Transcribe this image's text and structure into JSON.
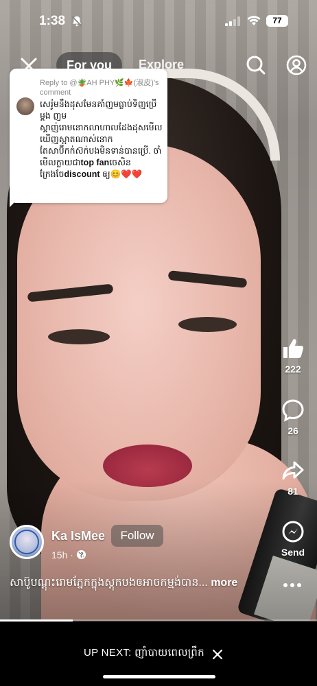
{
  "status_bar": {
    "time": "1:38",
    "battery": "77",
    "icons": [
      "bell-off-icon",
      "cellular-signal-icon",
      "wifi-icon",
      "battery-icon"
    ]
  },
  "top_nav": {
    "tabs": [
      {
        "label": "For you",
        "active": true
      },
      {
        "label": "Explore",
        "active": false
      }
    ],
    "icons": [
      "close-icon",
      "search-icon",
      "profile-icon"
    ]
  },
  "comment_card": {
    "reply_to": "Reply to @🪴AH PHY🌿🍁(淑皮)'s comment",
    "text_part1": "សេរ៉ូមនឹងដុសមែនគាំញមធ្លាប់ទិញប្រើម្តង ញមស្គាញ់រោមនោកលាហាលដែងដុសមើលឃើញស្អាតណាស់នោក តែសាប៊ីកក់ស៊ក់បងមិនទាន់បានប្រើ. ចាំមើលក្លាយជា",
    "bold1": "top fan",
    "text_part2": "ចេសិនក្រែងចែ",
    "bold2": "discount",
    "text_part3": " ឲ្យ😊❤️❤️"
  },
  "actions": {
    "likes": "222",
    "comments": "26",
    "shares": "81",
    "send_label": "Send"
  },
  "creator": {
    "name": "Ka IsMee",
    "follow_label": "Follow",
    "posted": "15h ·"
  },
  "caption": {
    "text": "សាប៊ូបណ្តុះរោមភ្នែកក្នុងស្តុកបងឲអាចកម្មង់បាន...",
    "more": "more"
  },
  "playback": {
    "progress": 0.23
  },
  "up_next": {
    "label": "UP NEXT: ញាំបាយពេលព្រឹក"
  },
  "colors": {
    "accent": "#ffffff",
    "bar_bg": "#000000",
    "heart": "#e02b2b"
  }
}
